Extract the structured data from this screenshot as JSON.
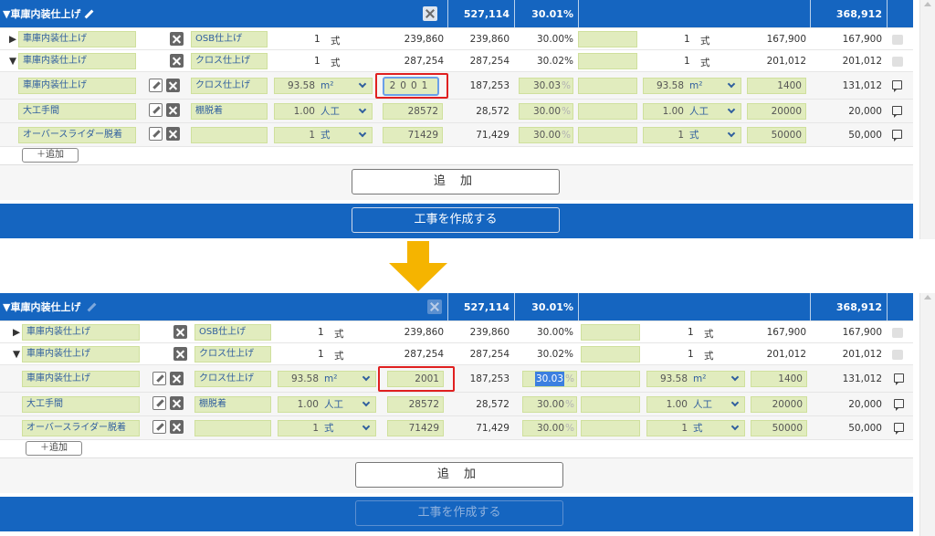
{
  "panels": [
    {
      "header": {
        "title": "▼車庫内装仕上げ",
        "total": "527,114",
        "rate": "30.01%",
        "cost_total": "368,912"
      },
      "group_rows": [
        {
          "toggle": "▶",
          "name": "車庫内装仕上げ",
          "spec": "OSB仕上げ",
          "qty": "1",
          "unit": "式",
          "sell_unit": "239,860",
          "sell_amount": "239,860",
          "rate": "30.00%",
          "cost_qty": "1",
          "cost_unit": "式",
          "cost_price": "167,900",
          "cost_amount": "167,900"
        },
        {
          "toggle": "▼",
          "name": "車庫内装仕上げ",
          "spec": "クロス仕上げ",
          "qty": "1",
          "unit": "式",
          "sell_unit": "287,254",
          "sell_amount": "287,254",
          "rate": "30.02%",
          "cost_qty": "1",
          "cost_unit": "式",
          "cost_price": "201,012",
          "cost_amount": "201,012"
        }
      ],
      "detail_rows": [
        {
          "name": "車庫内装仕上げ",
          "spec": "クロス仕上げ",
          "qty": "93.58",
          "unit": "m²",
          "unit_price": "2001",
          "amount": "187,253",
          "rate": "30.03",
          "pct": "%",
          "cost_qty": "93.58",
          "cost_unit": "m²",
          "cost_price": "1400",
          "cost_amount": "131,012"
        },
        {
          "name": "大工手間",
          "spec": "棚脱着",
          "qty": "1.00",
          "unit": "人工",
          "unit_price": "28572",
          "amount": "28,572",
          "rate": "30.00",
          "pct": "%",
          "cost_qty": "1.00",
          "cost_unit": "人工",
          "cost_price": "20000",
          "cost_amount": "20,000"
        },
        {
          "name": "オーバースライダー脱着",
          "spec": "",
          "qty": "1",
          "unit": "式",
          "unit_price": "71429",
          "amount": "71,429",
          "rate": "30.00",
          "pct": "%",
          "cost_qty": "1",
          "cost_unit": "式",
          "cost_price": "50000",
          "cost_amount": "50,000"
        }
      ],
      "small_add": "＋追加",
      "big_add": "追 加",
      "create": "工事を作成する"
    },
    {
      "header": {
        "title": "▼車庫内装仕上げ",
        "total": "527,114",
        "rate": "30.01%",
        "cost_total": "368,912"
      },
      "group_rows": [
        {
          "toggle": "▶",
          "name": "車庫内装仕上げ",
          "spec": "OSB仕上げ",
          "qty": "1",
          "unit": "式",
          "sell_unit": "239,860",
          "sell_amount": "239,860",
          "rate": "30.00%",
          "cost_qty": "1",
          "cost_unit": "式",
          "cost_price": "167,900",
          "cost_amount": "167,900"
        },
        {
          "toggle": "▼",
          "name": "車庫内装仕上げ",
          "spec": "クロス仕上げ",
          "qty": "1",
          "unit": "式",
          "sell_unit": "287,254",
          "sell_amount": "287,254",
          "rate": "30.02%",
          "cost_qty": "1",
          "cost_unit": "式",
          "cost_price": "201,012",
          "cost_amount": "201,012"
        }
      ],
      "detail_rows": [
        {
          "name": "車庫内装仕上げ",
          "spec": "クロス仕上げ",
          "qty": "93.58",
          "unit": "m²",
          "unit_price": "2001",
          "amount": "187,253",
          "rate": "30.03",
          "pct": "%",
          "cost_qty": "93.58",
          "cost_unit": "m²",
          "cost_price": "1400",
          "cost_amount": "131,012"
        },
        {
          "name": "大工手間",
          "spec": "棚脱着",
          "qty": "1.00",
          "unit": "人工",
          "unit_price": "28572",
          "amount": "28,572",
          "rate": "30.00",
          "pct": "%",
          "cost_qty": "1.00",
          "cost_unit": "人工",
          "cost_price": "20000",
          "cost_amount": "20,000"
        },
        {
          "name": "オーバースライダー脱着",
          "spec": "",
          "qty": "1",
          "unit": "式",
          "unit_price": "71429",
          "amount": "71,429",
          "rate": "30.00",
          "pct": "%",
          "cost_qty": "1",
          "cost_unit": "式",
          "cost_price": "50000",
          "cost_amount": "50,000"
        }
      ],
      "small_add": "＋追加",
      "big_add": "追 加",
      "create": "工事を作成する"
    }
  ],
  "colors": {
    "header_blue": "#1565c0",
    "cell_green": "#e1ecbe",
    "highlight_red": "#e02020",
    "arrow_yellow": "#f5b400"
  },
  "icons": {
    "edit": "pencil-icon",
    "delete": "close-box-icon",
    "comment": "comment-icon",
    "like": "thumb-up-icon",
    "transition": "down-arrow-icon"
  }
}
